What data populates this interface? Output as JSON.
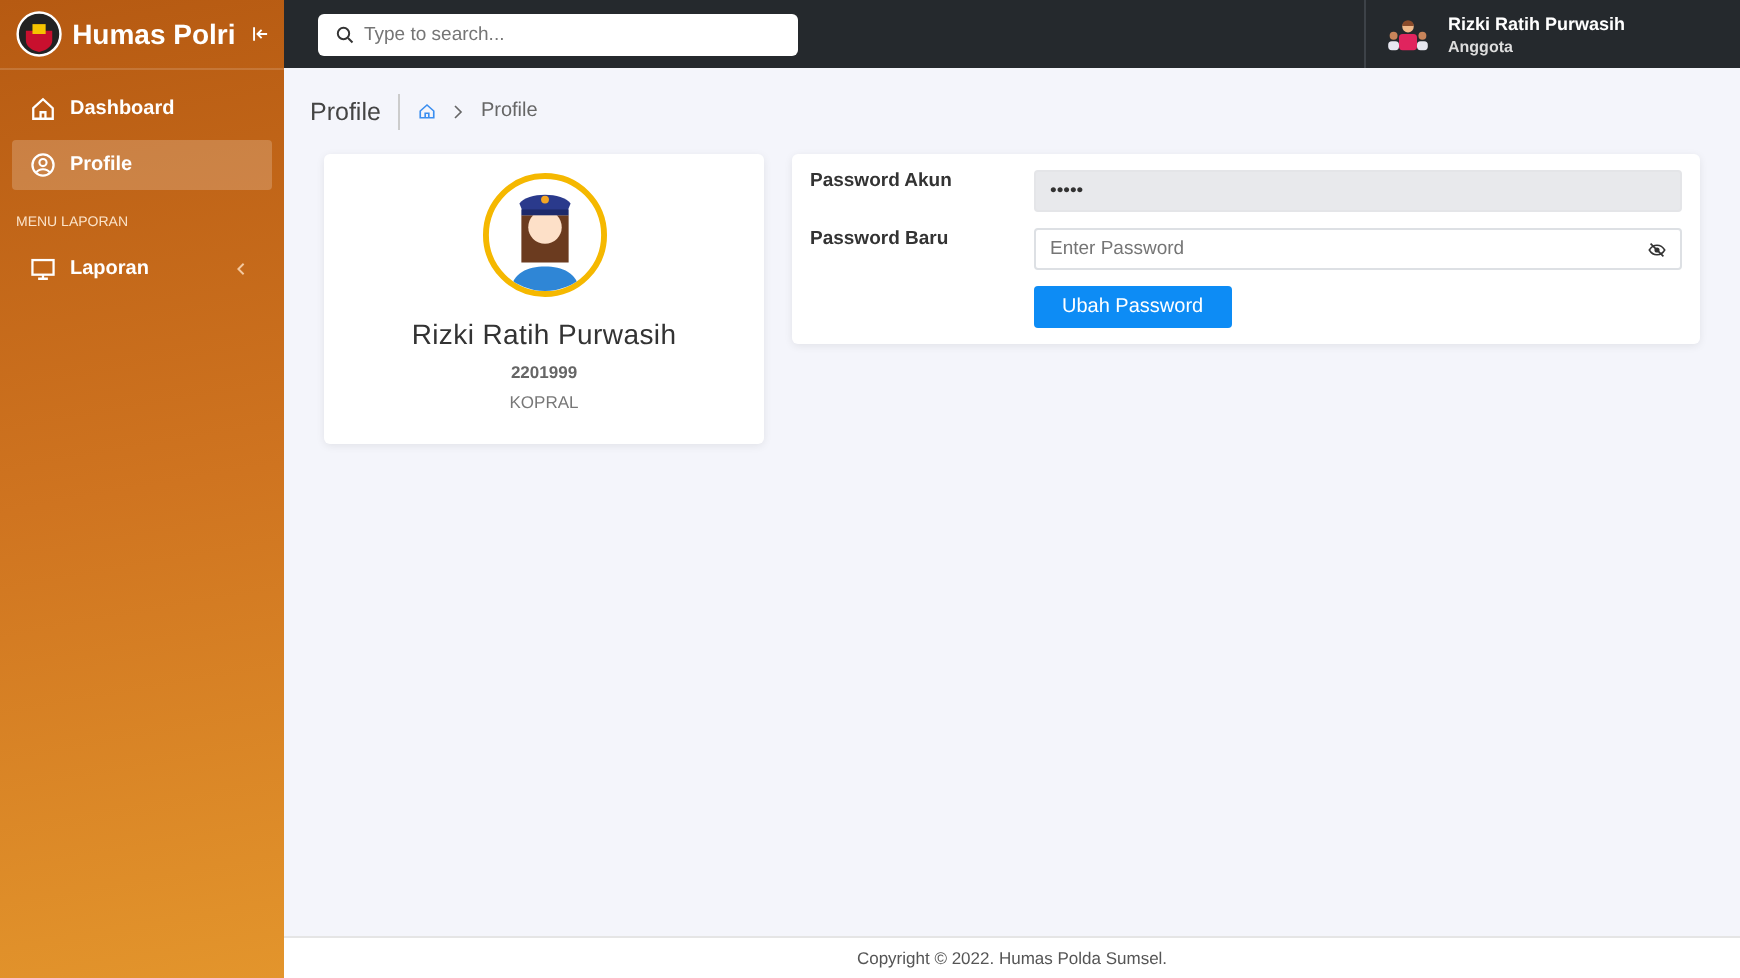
{
  "brand": {
    "title": "Humas Polri"
  },
  "search": {
    "placeholder": "Type to search..."
  },
  "user": {
    "name": "Rizki Ratih Purwasih",
    "role": "Anggota"
  },
  "sidebar": {
    "items": [
      {
        "kind": "link",
        "label": "Dashboard",
        "selected": false
      },
      {
        "kind": "link",
        "label": "Profile",
        "selected": true
      },
      {
        "kind": "header",
        "label": "MENU LAPORAN"
      },
      {
        "kind": "submenu",
        "label": "Laporan",
        "selected": false,
        "expanded": false
      }
    ]
  },
  "page": {
    "title": "Profile",
    "breadcrumb": "Profile"
  },
  "profile": {
    "name": "Rizki Ratih Purwasih",
    "id_number": "2201999",
    "rank": "KOPRAL"
  },
  "password_form": {
    "fields": [
      {
        "label": "Password Akun",
        "value": "•••••",
        "disabled": true
      },
      {
        "label": "Password Baru",
        "placeholder": "Enter Password",
        "disabled": false
      }
    ],
    "button": "Ubah Password"
  },
  "footer": "Copyright © 2022. Humas Polda Sumsel."
}
